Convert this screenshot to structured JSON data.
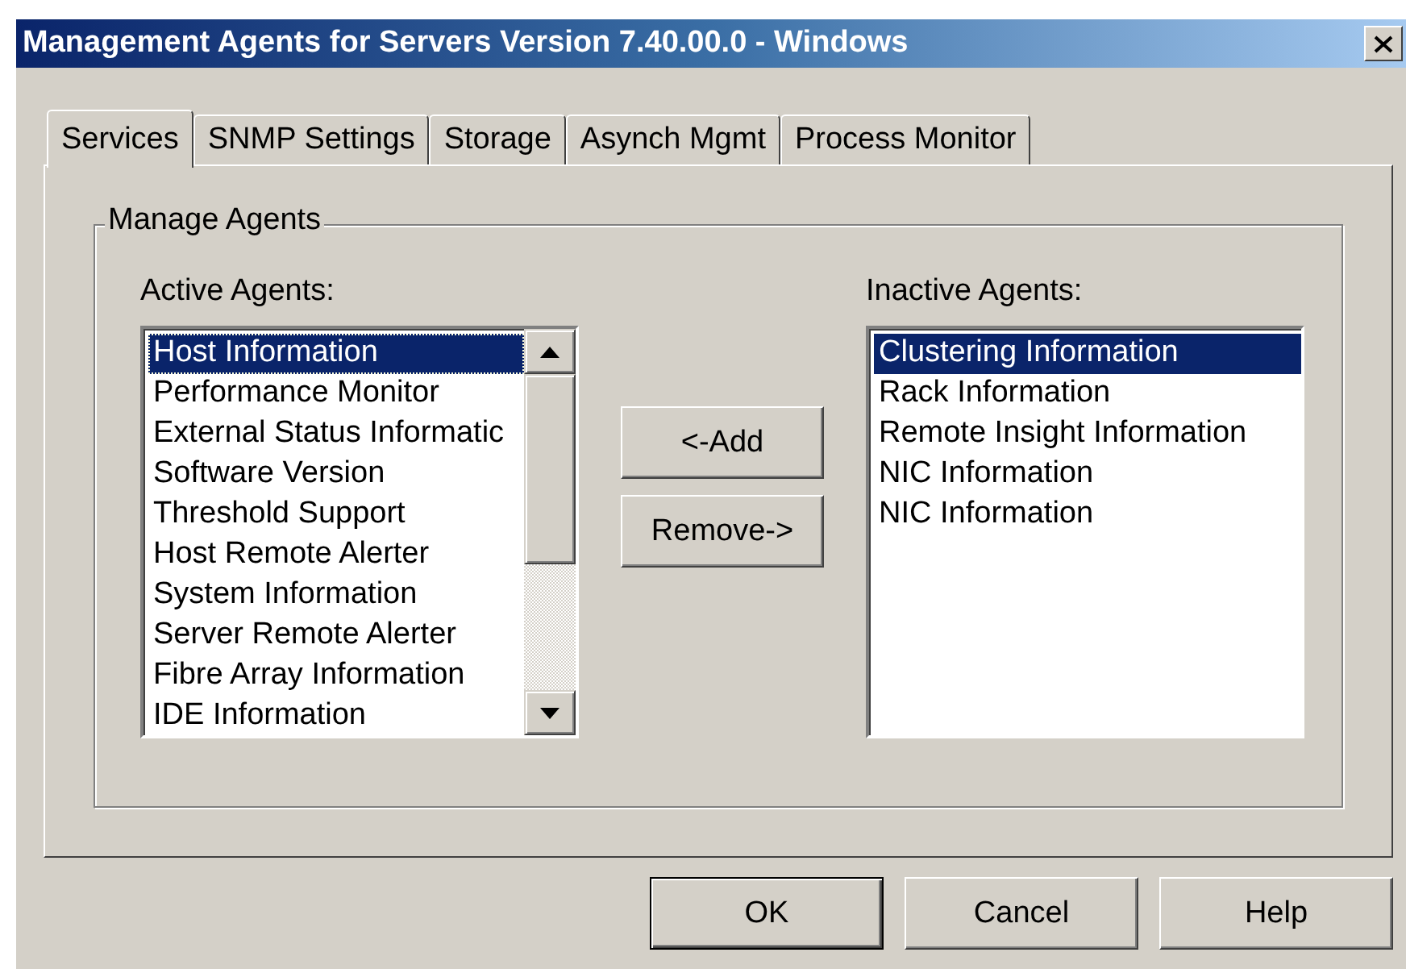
{
  "window": {
    "title": "Management Agents for Servers Version 7.40.00.0 - Windows"
  },
  "tabs": [
    {
      "label": "Services",
      "selected": true
    },
    {
      "label": "SNMP Settings",
      "selected": false
    },
    {
      "label": "Storage",
      "selected": false
    },
    {
      "label": "Asynch Mgmt",
      "selected": false
    },
    {
      "label": "Process Monitor",
      "selected": false
    }
  ],
  "group": {
    "title": "Manage Agents"
  },
  "active_agents": {
    "label": "Active Agents:",
    "items": [
      {
        "label": "Host Information",
        "selected": true
      },
      {
        "label": "Performance Monitor",
        "selected": false
      },
      {
        "label": "External Status Informatic",
        "selected": false
      },
      {
        "label": "Software Version",
        "selected": false
      },
      {
        "label": "Threshold Support",
        "selected": false
      },
      {
        "label": "Host Remote Alerter",
        "selected": false
      },
      {
        "label": "System Information",
        "selected": false
      },
      {
        "label": "Server Remote Alerter",
        "selected": false
      },
      {
        "label": "Fibre Array Information",
        "selected": false
      },
      {
        "label": "IDE Information",
        "selected": false
      }
    ]
  },
  "move_buttons": [
    "<-Add",
    "Remove->"
  ],
  "inactive_agents": {
    "label": "Inactive Agents:",
    "items": [
      {
        "label": "Clustering Information",
        "selected": true
      },
      {
        "label": "Rack Information",
        "selected": false
      },
      {
        "label": "Remote Insight Information",
        "selected": false
      },
      {
        "label": "NIC Information",
        "selected": false
      },
      {
        "label": "NIC Information",
        "selected": false
      }
    ]
  },
  "buttons": [
    {
      "label": "OK",
      "default": true
    },
    {
      "label": "Cancel",
      "default": false
    },
    {
      "label": "Help",
      "default": false
    }
  ]
}
